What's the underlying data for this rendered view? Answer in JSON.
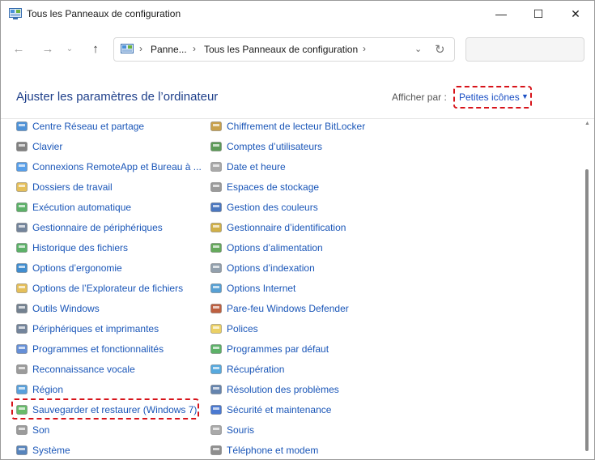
{
  "window": {
    "title": "Tous les Panneaux de configuration",
    "icon": "control-panel-icon",
    "controls": {
      "minimize": "—",
      "maximize": "☐",
      "close": "✕"
    }
  },
  "nav": {
    "back": "←",
    "forward": "→",
    "recent": "⌄",
    "up": "↑",
    "breadcrumb": [
      "Panne...",
      "Tous les Panneaux de configuration"
    ],
    "separator": "›",
    "dropdown": "⌄",
    "refresh": "↻",
    "search_placeholder": ""
  },
  "header": {
    "title": "Ajuster les paramètres de l’ordinateur",
    "view_label": "Afficher par :",
    "view_value": "Petites icônes",
    "view_arrow": "▼"
  },
  "colors": {
    "link": "#1a56b8",
    "heading": "#1e3f8a",
    "highlight": "#d7131a"
  },
  "items_left": [
    {
      "label": "Centre Réseau et partage",
      "icon": "network-icon"
    },
    {
      "label": "Clavier",
      "icon": "keyboard-icon"
    },
    {
      "label": "Connexions RemoteApp et Bureau à ...",
      "icon": "remoteapp-icon"
    },
    {
      "label": "Dossiers de travail",
      "icon": "work-folders-icon"
    },
    {
      "label": "Exécution automatique",
      "icon": "autoplay-icon"
    },
    {
      "label": "Gestionnaire de périphériques",
      "icon": "device-manager-icon"
    },
    {
      "label": "Historique des fichiers",
      "icon": "file-history-icon"
    },
    {
      "label": "Options d’ergonomie",
      "icon": "ease-of-access-icon"
    },
    {
      "label": "Options de l’Explorateur de fichiers",
      "icon": "folder-options-icon"
    },
    {
      "label": "Outils Windows",
      "icon": "windows-tools-icon"
    },
    {
      "label": "Périphériques et imprimantes",
      "icon": "printers-icon"
    },
    {
      "label": "Programmes et fonctionnalités",
      "icon": "programs-icon"
    },
    {
      "label": "Reconnaissance vocale",
      "icon": "microphone-icon"
    },
    {
      "label": "Région",
      "icon": "region-icon"
    },
    {
      "label": "Sauvegarder et restaurer (Windows 7)",
      "icon": "backup-restore-icon"
    },
    {
      "label": "Son",
      "icon": "speaker-icon"
    },
    {
      "label": "Système",
      "icon": "system-icon"
    }
  ],
  "items_right": [
    {
      "label": "Chiffrement de lecteur BitLocker",
      "icon": "bitlocker-icon"
    },
    {
      "label": "Comptes d’utilisateurs",
      "icon": "user-accounts-icon"
    },
    {
      "label": "Date et heure",
      "icon": "date-time-icon"
    },
    {
      "label": "Espaces de stockage",
      "icon": "storage-spaces-icon"
    },
    {
      "label": "Gestion des couleurs",
      "icon": "color-management-icon"
    },
    {
      "label": "Gestionnaire d’identification",
      "icon": "credential-manager-icon"
    },
    {
      "label": "Options d’alimentation",
      "icon": "power-options-icon"
    },
    {
      "label": "Options d’indexation",
      "icon": "indexing-icon"
    },
    {
      "label": "Options Internet",
      "icon": "internet-options-icon"
    },
    {
      "label": "Pare-feu Windows Defender",
      "icon": "firewall-icon"
    },
    {
      "label": "Polices",
      "icon": "fonts-icon"
    },
    {
      "label": "Programmes par défaut",
      "icon": "default-programs-icon"
    },
    {
      "label": "Récupération",
      "icon": "recovery-icon"
    },
    {
      "label": "Résolution des problèmes",
      "icon": "troubleshooting-icon"
    },
    {
      "label": "Sécurité et maintenance",
      "icon": "security-flag-icon"
    },
    {
      "label": "Souris",
      "icon": "mouse-icon"
    },
    {
      "label": "Téléphone et modem",
      "icon": "phone-modem-icon"
    }
  ]
}
